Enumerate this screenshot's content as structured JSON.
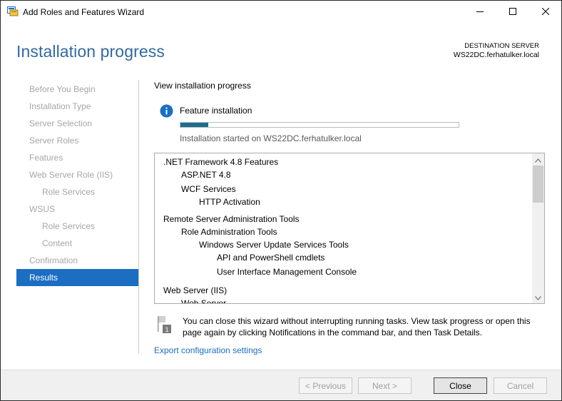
{
  "window": {
    "title": "Add Roles and Features Wizard"
  },
  "header": {
    "title": "Installation progress",
    "destination_label": "DESTINATION SERVER",
    "destination_server": "WS22DC.ferhatulker.local"
  },
  "nav": {
    "items": [
      {
        "label": "Before You Begin",
        "level": 0,
        "active": false
      },
      {
        "label": "Installation Type",
        "level": 0,
        "active": false
      },
      {
        "label": "Server Selection",
        "level": 0,
        "active": false
      },
      {
        "label": "Server Roles",
        "level": 0,
        "active": false
      },
      {
        "label": "Features",
        "level": 0,
        "active": false
      },
      {
        "label": "Web Server Role (IIS)",
        "level": 0,
        "active": false
      },
      {
        "label": "Role Services",
        "level": 1,
        "active": false
      },
      {
        "label": "WSUS",
        "level": 0,
        "active": false
      },
      {
        "label": "Role Services",
        "level": 1,
        "active": false
      },
      {
        "label": "Content",
        "level": 1,
        "active": false
      },
      {
        "label": "Confirmation",
        "level": 0,
        "active": false
      },
      {
        "label": "Results",
        "level": 0,
        "active": true
      }
    ]
  },
  "main": {
    "heading": "View installation progress",
    "feature_label": "Feature installation",
    "progress_fraction": 0.1,
    "status": "Installation started on WS22DC.ferhatulker.local",
    "results": [
      {
        "text": ".NET Framework 4.8 Features",
        "level": 0
      },
      {
        "text": "ASP.NET 4.8",
        "level": 1
      },
      {
        "text": "WCF Services",
        "level": 1
      },
      {
        "text": "HTTP Activation",
        "level": 2
      },
      {
        "text": "Remote Server Administration Tools",
        "level": 0
      },
      {
        "text": "Role Administration Tools",
        "level": 1
      },
      {
        "text": "Windows Server Update Services Tools",
        "level": 2
      },
      {
        "text": "API and PowerShell cmdlets",
        "level": 3
      },
      {
        "text": "User Interface Management Console",
        "level": 3
      },
      {
        "text": "Web Server (IIS)",
        "level": 0
      },
      {
        "text": "Web Server",
        "level": 1
      }
    ],
    "note": "You can close this wizard without interrupting running tasks. View task progress or open this page again by clicking Notifications in the command bar, and then Task Details.",
    "note_badge": "1",
    "export_link": "Export configuration settings"
  },
  "footer": {
    "previous": "< Previous",
    "next": "Next >",
    "close": "Close",
    "cancel": "Cancel"
  },
  "colors": {
    "accent": "#1b6ec2",
    "title": "#2f6aa1",
    "progress": "#1b6e8c"
  }
}
